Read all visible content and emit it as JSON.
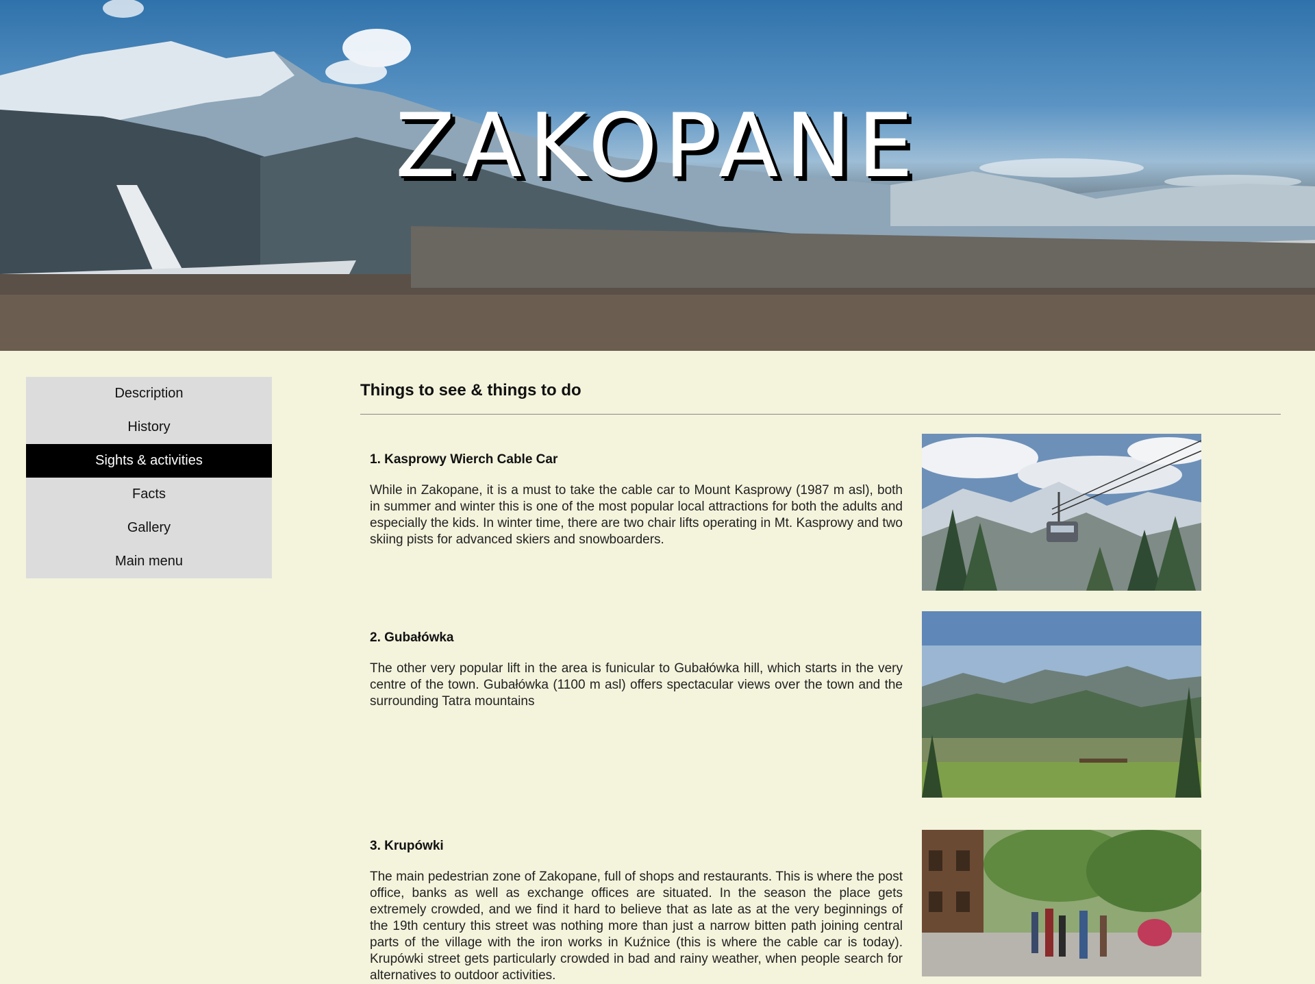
{
  "hero": {
    "title": "ZAKOPANE"
  },
  "sidebar": {
    "items": [
      {
        "label": "Description",
        "active": false
      },
      {
        "label": "History",
        "active": false
      },
      {
        "label": "Sights & activities",
        "active": true
      },
      {
        "label": "Facts",
        "active": false
      },
      {
        "label": "Gallery",
        "active": false
      },
      {
        "label": "Main menu",
        "active": false
      }
    ]
  },
  "main": {
    "section_title": "Things to see & things to do",
    "items": [
      {
        "title": "1. Kasprowy Wierch Cable Car",
        "body": "While in Zakopane, it is a must to take the cable car to Mount Kasprowy (1987 m asl), both in summer and winter this is one of the most popular local attractions for both the adults and especially the kids. In winter time, there are two chair lifts operating in Mt. Kasprowy and two skiing pists for advanced skiers and snowboarders."
      },
      {
        "title": "2. Gubałówka",
        "body": "The other very popular lift in the area is funicular to Gubałówka hill, which starts in the very centre of the town. Gubałówka (1100 m asl) offers spectacular views over the town and the surrounding Tatra mountains"
      },
      {
        "title": "3. Krupówki",
        "body": "The main pedestrian zone of Zakopane, full of shops and restaurants. This is where the post office, banks as well as exchange offices are situated. In the season the place gets extremely crowded, and we find it hard to believe that as late as at the very beginnings of the 19th century this street was nothing more than just a narrow bitten path joining central parts of the village with the iron works in Kuźnice (this is where the cable car is today). Krupówki street gets particularly crowded in bad and rainy weather, when people search for alternatives to outdoor activities."
      }
    ]
  }
}
